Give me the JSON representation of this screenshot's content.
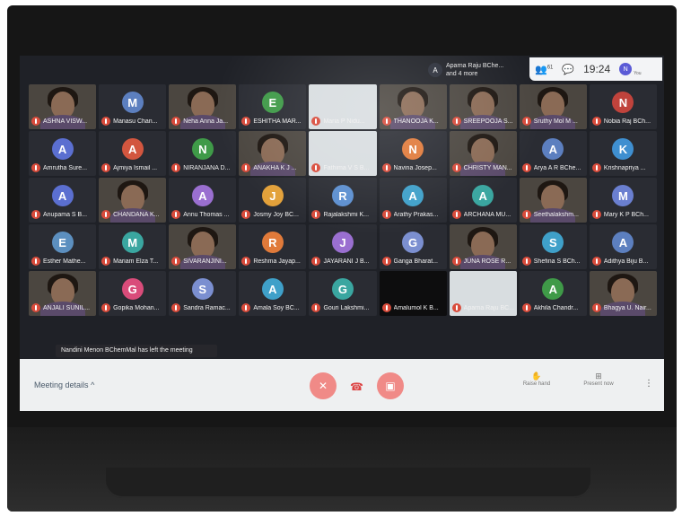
{
  "top": {
    "presenter_initial": "A",
    "presenter_line1": "Aparna Raju BChe...",
    "presenter_line2": "and 4 more",
    "people_count": "61",
    "time": "19:24",
    "self_initial": "N",
    "self_label": "You"
  },
  "toast": "Nandini Menon BChemMal has left the meeting",
  "controls": {
    "meeting_details": "Meeting details",
    "raise_hand": "Raise hand",
    "present_now": "Present now"
  },
  "colors": {
    "mute_red": "#d94c3c",
    "control_red": "#f08a87"
  },
  "participants": [
    {
      "name": "ASHNA VISW...",
      "type": "video"
    },
    {
      "name": "Manasu Chan...",
      "type": "avatar",
      "initial": "M",
      "color": "#5c7fbf"
    },
    {
      "name": "Neha Anna Ja...",
      "type": "video"
    },
    {
      "name": "ESHITHA MAR...",
      "type": "avatar",
      "initial": "E",
      "color": "#3f9a48"
    },
    {
      "name": "Maria P Nidu...",
      "type": "light"
    },
    {
      "name": "THANOOJA K...",
      "type": "video"
    },
    {
      "name": "SREEPOOJA S...",
      "type": "video"
    },
    {
      "name": "Sruthy Mol M ...",
      "type": "video"
    },
    {
      "name": "Nobia Raj BCh...",
      "type": "avatar",
      "initial": "N",
      "color": "#c0433c"
    },
    {
      "name": "Amrutha Sure...",
      "type": "avatar",
      "initial": "A",
      "color": "#5b6fd0"
    },
    {
      "name": "Ajmiya Ismail ...",
      "type": "avatar",
      "initial": "A",
      "color": "#d2563f"
    },
    {
      "name": "NIRANJANA D...",
      "type": "avatar",
      "initial": "N",
      "color": "#3f9a48"
    },
    {
      "name": "ANAKHA K J ...",
      "type": "video"
    },
    {
      "name": "Fathima V S B...",
      "type": "light"
    },
    {
      "name": "Navina Josep...",
      "type": "avatar",
      "initial": "N",
      "color": "#e07a3a"
    },
    {
      "name": "CHRISTY MAN...",
      "type": "video"
    },
    {
      "name": "Arya A R BChe...",
      "type": "avatar",
      "initial": "A",
      "color": "#5c7fbf"
    },
    {
      "name": "Krishnapriya ...",
      "type": "avatar",
      "initial": "K",
      "color": "#3f8fd0"
    },
    {
      "name": "Anupama S B...",
      "type": "avatar",
      "initial": "A",
      "color": "#5b6fd0"
    },
    {
      "name": "CHANDANA K...",
      "type": "video"
    },
    {
      "name": "Annu Thomas ...",
      "type": "avatar",
      "initial": "A",
      "color": "#9a6fd0"
    },
    {
      "name": "Josmy Joy BC...",
      "type": "avatar",
      "initial": "J",
      "color": "#e3a13a"
    },
    {
      "name": "Rajalakshmi K...",
      "type": "avatar",
      "initial": "R",
      "color": "#5c8fd0"
    },
    {
      "name": "Arathy Prakas...",
      "type": "avatar",
      "initial": "A",
      "color": "#3fa0c9"
    },
    {
      "name": "ARCHANA MU...",
      "type": "avatar",
      "initial": "A",
      "color": "#3aa6a0"
    },
    {
      "name": "Seethalakshm...",
      "type": "video"
    },
    {
      "name": "Mary K P BCh...",
      "type": "avatar",
      "initial": "M",
      "color": "#6a7fd0"
    },
    {
      "name": "Esther Mathe...",
      "type": "avatar",
      "initial": "E",
      "color": "#5c8fbf"
    },
    {
      "name": "Mariam Elza T...",
      "type": "avatar",
      "initial": "M",
      "color": "#3aa6a0"
    },
    {
      "name": "SIVARANJINI...",
      "type": "video"
    },
    {
      "name": "Reshma Jayap...",
      "type": "avatar",
      "initial": "R",
      "color": "#e07a3a"
    },
    {
      "name": "JAYARANI J B...",
      "type": "avatar",
      "initial": "J",
      "color": "#9a6fd0"
    },
    {
      "name": "Ganga Bharat...",
      "type": "avatar",
      "initial": "G",
      "color": "#7b8fd0"
    },
    {
      "name": "JUNA ROSE R...",
      "type": "video"
    },
    {
      "name": "Shefina S BCh...",
      "type": "avatar",
      "initial": "S",
      "color": "#3fa0c9"
    },
    {
      "name": "Adithya Biju B...",
      "type": "avatar",
      "initial": "A",
      "color": "#5c7fbf"
    },
    {
      "name": "ANJALI SUNIL...",
      "type": "video"
    },
    {
      "name": "Gopika Mohan...",
      "type": "avatar",
      "initial": "G",
      "color": "#d94c7a"
    },
    {
      "name": "Sandra Ramac...",
      "type": "avatar",
      "initial": "S",
      "color": "#7b8fd0"
    },
    {
      "name": "Amala Soy BC...",
      "type": "avatar",
      "initial": "A",
      "color": "#3fa0c9"
    },
    {
      "name": "Gouri Lakshmi...",
      "type": "avatar",
      "initial": "G",
      "color": "#3aa6a0"
    },
    {
      "name": "Amalumol K B...",
      "type": "black"
    },
    {
      "name": "Aparna Raju BC...",
      "type": "light"
    },
    {
      "name": "Akhila Chandr...",
      "type": "avatar",
      "initial": "A",
      "color": "#3f9a48"
    },
    {
      "name": "Bhagya U. Nair...",
      "type": "video"
    }
  ]
}
